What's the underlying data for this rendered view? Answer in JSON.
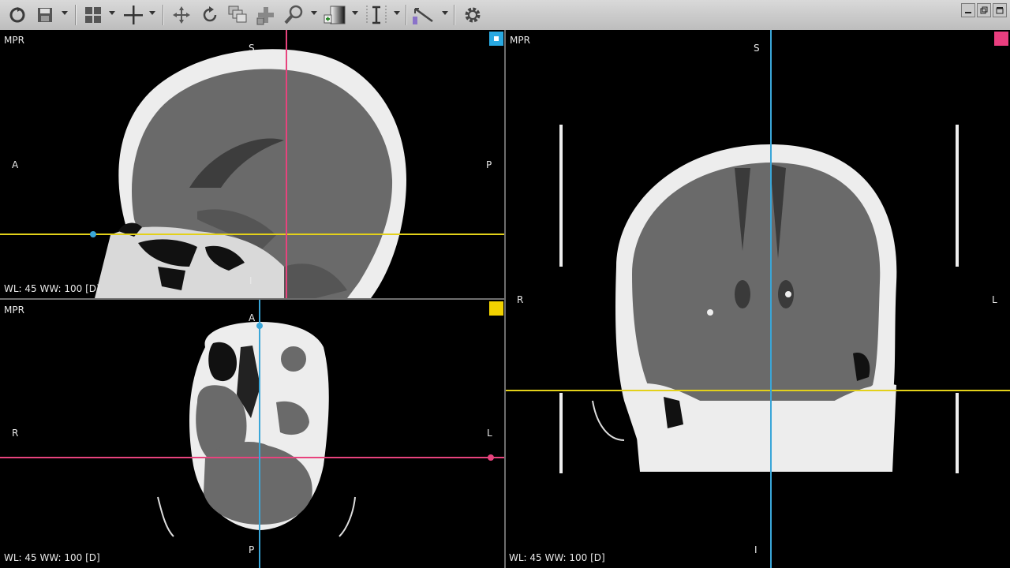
{
  "toolbar": {
    "buttons": [
      {
        "name": "refresh-icon"
      },
      {
        "name": "save-icon"
      },
      {
        "name": "layout-grid-icon"
      },
      {
        "name": "crosshair-icon"
      },
      {
        "name": "pan-icon"
      },
      {
        "name": "rotate-icon"
      },
      {
        "name": "stack-icon"
      },
      {
        "name": "move-icon"
      },
      {
        "name": "zoom-icon"
      },
      {
        "name": "window-level-icon"
      },
      {
        "name": "thickness-icon"
      },
      {
        "name": "measure-icon"
      },
      {
        "name": "settings-gear-icon"
      }
    ]
  },
  "viewports": {
    "sagittal": {
      "title": "MPR",
      "window_info": "WL: 45 WW: 100 [D]",
      "orient_top": "S",
      "orient_left": "A",
      "orient_right": "P",
      "orient_bottom": "I",
      "badge_color": "#29a9e1"
    },
    "axial": {
      "title": "MPR",
      "window_info": "WL: 45 WW: 100 [D]",
      "orient_top": "A",
      "orient_left": "R",
      "orient_right": "L",
      "orient_bottom": "P",
      "badge_color": "#f2d200"
    },
    "coronal": {
      "title": "MPR",
      "window_info": "WL: 45 WW: 100 [D]",
      "orient_top": "S",
      "orient_left": "R",
      "orient_right": "L",
      "orient_bottom": "I",
      "badge_color": "#ea3e7f"
    }
  },
  "colors": {
    "sagittal_line": "#e8437d",
    "axial_line": "#e3d11a",
    "coronal_line": "#3aa6d8"
  }
}
